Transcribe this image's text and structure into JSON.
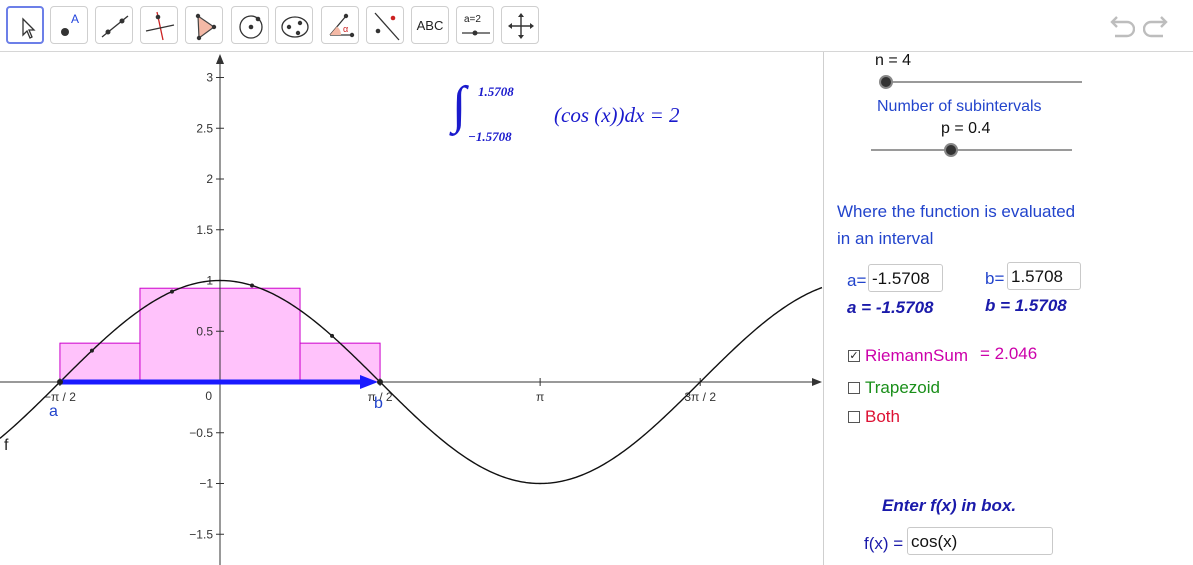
{
  "toolbar": {
    "tools": [
      {
        "name": "move-tool",
        "label": ""
      },
      {
        "name": "point-tool",
        "label": "A"
      },
      {
        "name": "line-tool",
        "label": ""
      },
      {
        "name": "perpendicular-tool",
        "label": ""
      },
      {
        "name": "polygon-tool",
        "label": ""
      },
      {
        "name": "circle-tool",
        "label": ""
      },
      {
        "name": "ellipse-tool",
        "label": ""
      },
      {
        "name": "angle-tool",
        "label": "α"
      },
      {
        "name": "reflect-tool",
        "label": ""
      },
      {
        "name": "text-tool",
        "label": "ABC"
      },
      {
        "name": "slider-tool",
        "label": "a=2"
      },
      {
        "name": "move-graphics-tool",
        "label": ""
      }
    ]
  },
  "graph": {
    "y_ticks": [
      "3",
      "2.5",
      "2",
      "1.5",
      "1",
      "0.5",
      "0",
      "−0.5",
      "−1",
      "−1.5"
    ],
    "x_ticks": [
      "−π / 2",
      "π / 2",
      "π",
      "3π / 2"
    ],
    "function_label": "f",
    "point_a_label": "a",
    "point_b_label": "b",
    "integral": {
      "upper": "1.5708",
      "lower": "−1.5708",
      "expression": "(cos (x))dx = 2"
    },
    "rectangles": [
      {
        "x_from": -1.5708,
        "x_to": -0.7854,
        "height": 0.3827
      },
      {
        "x_from": -0.7854,
        "x_to": 0.0,
        "height": 0.9239
      },
      {
        "x_from": 0.0,
        "x_to": 0.7854,
        "height": 0.9239
      },
      {
        "x_from": 0.7854,
        "x_to": 1.5708,
        "height": 0.3827
      }
    ],
    "colors": {
      "riemann": "#cc00cc",
      "arrow": "#1a1aff"
    }
  },
  "panel": {
    "n_label": "n = 4",
    "n_value": 4,
    "n_caption": "Number of subintervals",
    "p_label": "p = 0.4",
    "p_value": 0.4,
    "where_line1": "Where the function is evaluated",
    "where_line2": "in an interval",
    "a_prefix": "a=",
    "a_input": "-1.5708",
    "b_prefix": "b=",
    "b_input": "1.5708",
    "a_display": "a = -1.5708",
    "b_display": "b = 1.5708",
    "riemann_label": "RiemannSum",
    "riemann_value": "= 2.046",
    "riemann_checked": true,
    "trapezoid_label": "Trapezoid",
    "trapezoid_checked": false,
    "both_label": "Both",
    "both_checked": false,
    "enter_label": "Enter f(x) in box.",
    "fx_prefix": "f(x) =",
    "fx_input": "cos(x)"
  }
}
